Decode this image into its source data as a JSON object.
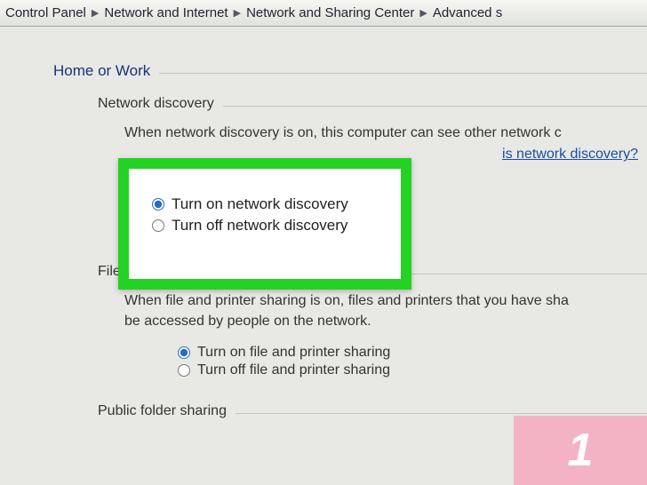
{
  "breadcrumb": {
    "items": [
      "Control Panel",
      "Network and Internet",
      "Network and Sharing Center",
      "Advanced s"
    ]
  },
  "profile": {
    "title": "Home or Work"
  },
  "sections": {
    "network_discovery": {
      "title": "Network discovery",
      "desc": "When network discovery is on, this computer can see other network c",
      "link_text": "is network discovery?",
      "radio_on": "Turn on network discovery",
      "radio_off": "Turn off network discovery"
    },
    "file_sharing": {
      "title": "File",
      "desc_line1": "When file and printer sharing is on, files and printers that you have sha",
      "desc_line2": "be accessed by people on the network.",
      "radio_on": "Turn on file and printer sharing",
      "radio_off": "Turn off file and printer sharing"
    },
    "public_folder": {
      "title": "Public folder sharing"
    }
  },
  "watermark": {
    "text": "1"
  }
}
